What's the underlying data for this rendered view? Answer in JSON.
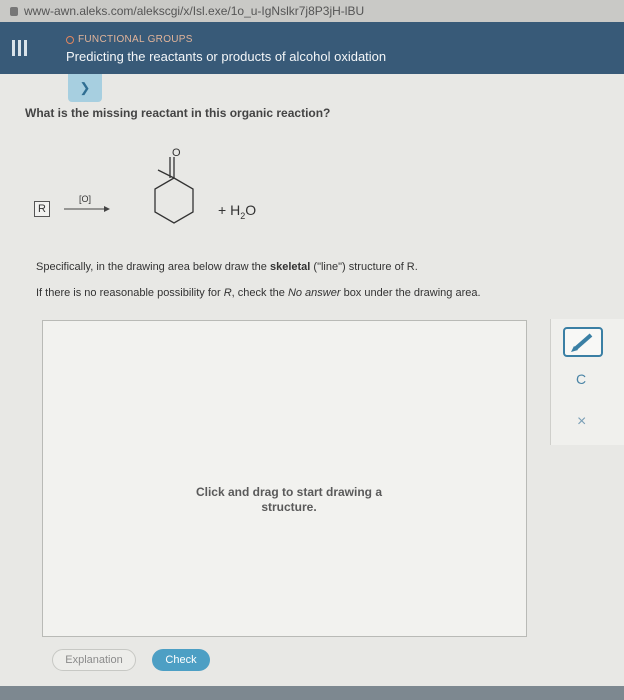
{
  "browser": {
    "url": "www-awn.aleks.com/alekscgi/x/Isl.exe/1o_u-IgNslkr7j8P3jH-lBU"
  },
  "header": {
    "topic": "FUNCTIONAL GROUPS",
    "title": "Predicting the reactants or products of alcohol oxidation"
  },
  "question": {
    "prompt": "What is the missing reactant in this organic reaction?",
    "reactant_label": "R",
    "oxidant": "[O]",
    "product_plus": "+ H",
    "product_sub": "2",
    "product_tail": "O",
    "carbonyl_atom": "O"
  },
  "instructions": {
    "line1_a": "Specifically, in the drawing area below draw the ",
    "line1_b": "skeletal",
    "line1_c": " (\"line\") structure of R.",
    "line2_a": "If there is no reasonable possibility for ",
    "line2_b": "R",
    "line2_c": ", check the ",
    "line2_d": "No answer",
    "line2_e": " box under the drawing area."
  },
  "drawing": {
    "hint_line1": "Click and drag to start drawing a",
    "hint_line2": "structure."
  },
  "toolbar": {
    "undo_glyph": "C",
    "clear_glyph": "×"
  },
  "buttons": {
    "explanation": "Explanation",
    "check": "Check"
  },
  "colors": {
    "header": "#385a78",
    "accent": "#3a7fa4",
    "check": "#4d9fc4"
  }
}
